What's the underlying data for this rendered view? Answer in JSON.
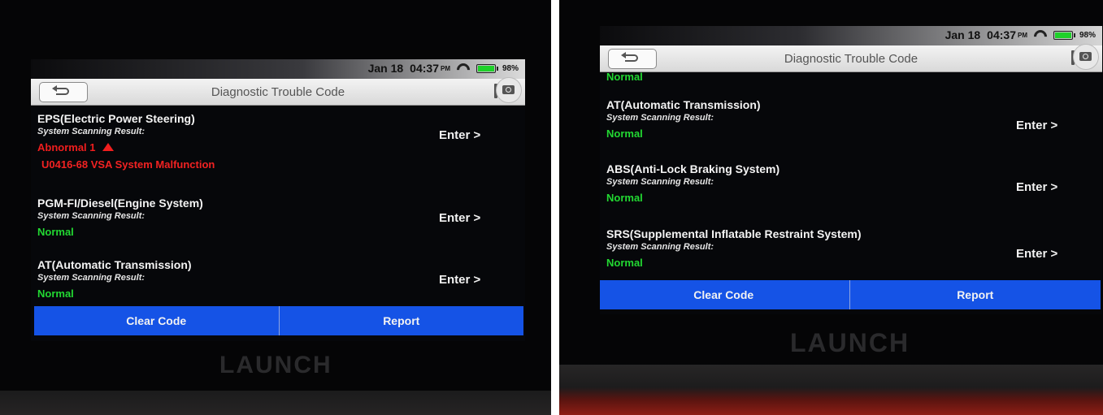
{
  "app": {
    "status_date": "Jan 18",
    "status_time": "04:37",
    "status_ampm": "PM",
    "battery": "98%",
    "title": "Diagnostic Trouble Code",
    "brand": "LAUNCH",
    "scan_label": "System Scanning Result:",
    "enter_label": "Enter >",
    "clear_label": "Clear Code",
    "report_label": "Report"
  },
  "colors": {
    "normal": "#22d832",
    "abnormal": "#f01e1e",
    "action_bar": "#1553e6"
  },
  "left_screen": {
    "systems": [
      {
        "name": "EPS(Electric Power Steering)",
        "status": "Abnormal 1",
        "fault": "U0416-68 VSA System Malfunction"
      },
      {
        "name": "PGM-FI/Diesel(Engine System)",
        "status": "Normal"
      },
      {
        "name": "AT(Automatic Transmission)",
        "status": "Normal"
      }
    ]
  },
  "right_screen": {
    "partial_status": "Normal",
    "systems": [
      {
        "name": "AT(Automatic Transmission)",
        "status": "Normal"
      },
      {
        "name": "ABS(Anti-Lock Braking System)",
        "status": "Normal"
      },
      {
        "name": "SRS(Supplemental Inflatable Restraint System)",
        "status": "Normal"
      }
    ]
  }
}
